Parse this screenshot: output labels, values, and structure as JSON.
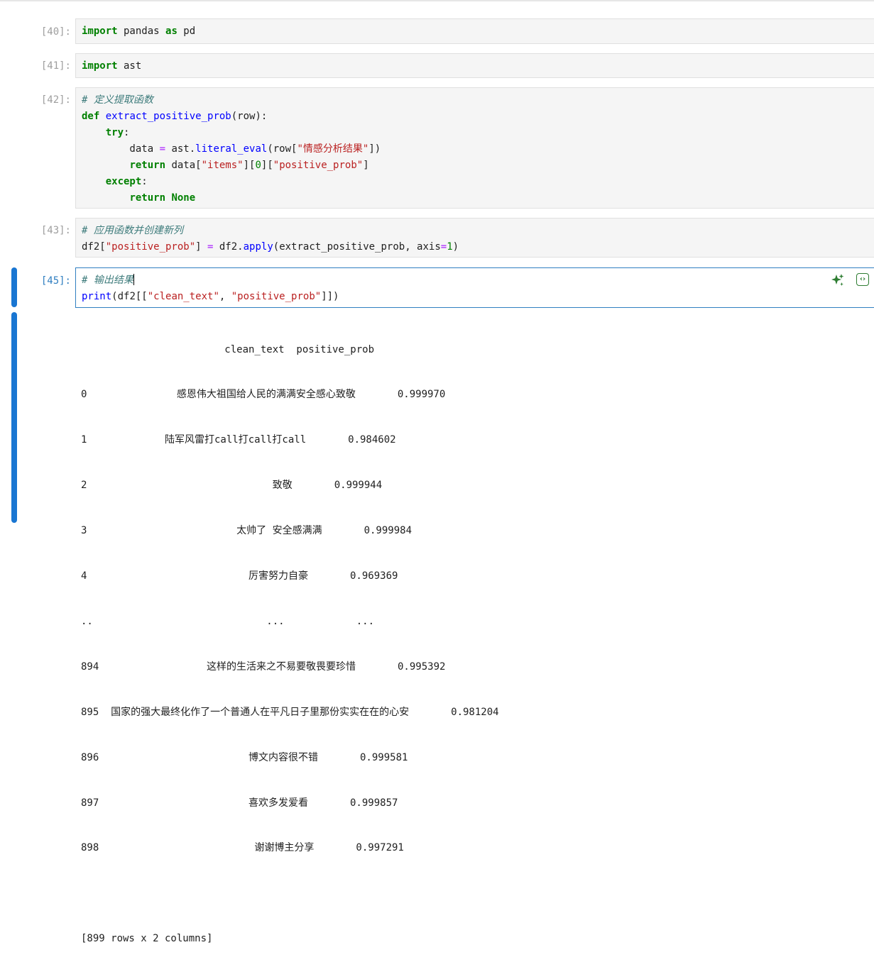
{
  "cells": [
    {
      "prompt": "[40]:",
      "lines": [
        "import pandas as pd"
      ]
    },
    {
      "prompt": "[41]:",
      "lines": [
        "import ast"
      ]
    },
    {
      "prompt": "[42]:",
      "lines": [
        "# 定义提取函数",
        "def extract_positive_prob(row):",
        "    try:",
        "        data = ast.literal_eval(row[\"情感分析结果\"])",
        "        return data[\"items\"][0][\"positive_prob\"]",
        "    except:",
        "        return None"
      ]
    },
    {
      "prompt": "[43]:",
      "lines": [
        "# 应用函数并创建新列",
        "df2[\"positive_prob\"] = df2.apply(extract_positive_prob, axis=1)"
      ]
    },
    {
      "prompt": "[45]:",
      "lines": [
        "# 输出结果",
        "print(df2[[\"clean_text\", \"positive_prob\"]])"
      ]
    }
  ],
  "output": {
    "header": "                        clean_text  positive_prob",
    "rows": [
      "0               感恩伟大祖国给人民的满满安全感心致敬       0.999970",
      "1             陆军风雷打call打call打call       0.984602",
      "2                               致敬       0.999944",
      "3                         太帅了 安全感满满       0.999984",
      "4                           厉害努力自豪       0.969369",
      "..                             ...            ...",
      "894                  这样的生活来之不易要敬畏要珍惜       0.995392",
      "895  国家的强大最终化作了一个普通人在平凡日子里那份实实在在的心安       0.981204",
      "896                         博文内容很不错       0.999581",
      "897                         喜欢多发爱看       0.999857",
      "898                          谢谢博主分享       0.997291",
      "",
      "[899 rows x 2 columns]"
    ]
  },
  "toolbar": {
    "ai_icon": "sparkle-icon",
    "code_icon": "code-icon",
    "code_glyph": "‹›"
  },
  "colors": {
    "accent": "#1976d2",
    "keyword": "#008000",
    "string": "#ba2121",
    "comment": "#3d7b7b"
  }
}
